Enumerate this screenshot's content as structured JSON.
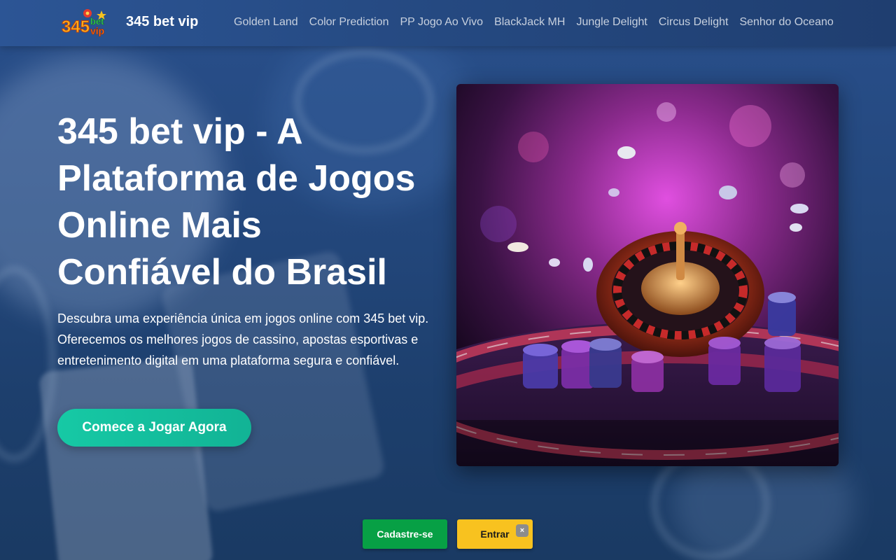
{
  "header": {
    "brand": "345 bet vip",
    "logo_text": {
      "digits": "345",
      "top": "bet",
      "bottom": "vip"
    },
    "nav": [
      "Golden Land",
      "Color Prediction",
      "PP Jogo Ao Vivo",
      "BlackJack MH",
      "Jungle Delight",
      "Circus Delight",
      "Senhor do Oceano"
    ]
  },
  "hero": {
    "title": "345 bet vip - A Plataforma de Jogos Online Mais Confiável do Brasil",
    "description": "Descubra uma experiência única em jogos online com 345 bet vip. Oferecemos os melhores jogos de cassino, apostas esportivas e entretenimento digital em uma plataforma segura e confiável.",
    "cta_label": "Comece a Jogar Agora"
  },
  "floating": {
    "register_label": "Cadastre-se",
    "login_label": "Entrar",
    "close_label": "×"
  },
  "colors": {
    "accent": "#16c9a5",
    "register": "#07a045",
    "login": "#f8c21f"
  },
  "icons": [
    "roulette-image",
    "close-icon",
    "logo"
  ]
}
